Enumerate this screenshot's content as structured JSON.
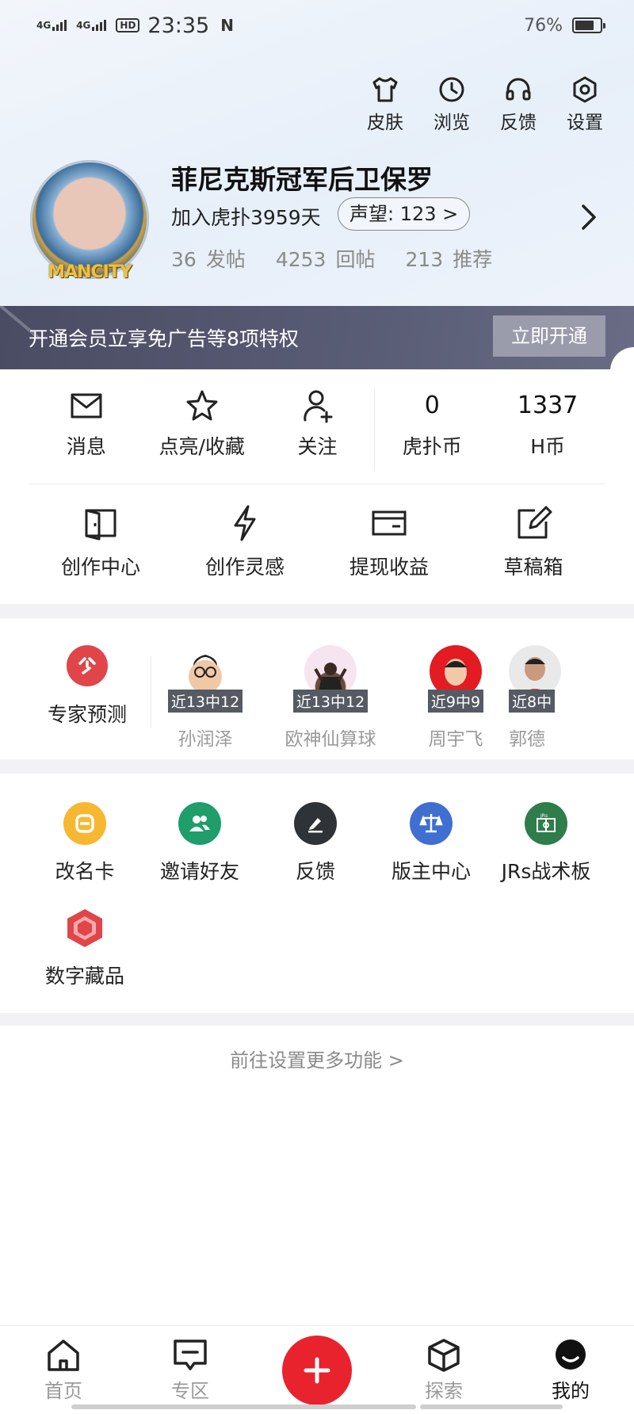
{
  "status_bar": {
    "net1": "4G",
    "net2": "4G",
    "hd": "HD",
    "time": "23:35",
    "nfc": "N",
    "battery": "76%",
    "battery_level": 0.76
  },
  "header_actions": [
    {
      "label": "皮肤",
      "icon": "shirt-icon"
    },
    {
      "label": "浏览",
      "icon": "clock-icon"
    },
    {
      "label": "反馈",
      "icon": "headset-icon"
    },
    {
      "label": "设置",
      "icon": "settings-icon"
    }
  ],
  "profile": {
    "username": "菲尼克斯冠军后卫保罗",
    "joined": "加入虎扑3959天",
    "reputation": "声望: 123",
    "avatar_badge": "MANCITY",
    "posts_count": "36",
    "posts_label": "发帖",
    "replies_count": "4253",
    "replies_label": "回帖",
    "recommend_count": "213",
    "recommend_label": "推荐"
  },
  "vip": {
    "text": "开通会员立享免广告等8项特权",
    "button": "立即开通"
  },
  "quick_row": [
    {
      "label": "消息",
      "icon": "mail-icon"
    },
    {
      "label": "点亮/收藏",
      "icon": "star-icon"
    },
    {
      "label": "关注",
      "icon": "add-user-icon"
    }
  ],
  "wallet": [
    {
      "value": "0",
      "label": "虎扑币"
    },
    {
      "value": "1337",
      "label": "H币"
    }
  ],
  "creator_row": [
    {
      "label": "创作中心",
      "icon": "door-icon"
    },
    {
      "label": "创作灵感",
      "icon": "lightning-icon"
    },
    {
      "label": "提现收益",
      "icon": "card-icon"
    },
    {
      "label": "草稿箱",
      "icon": "edit-icon"
    }
  ],
  "experts": {
    "title": "专家预测",
    "items": [
      {
        "tag": "近13中12",
        "name": "孙润泽"
      },
      {
        "tag": "近13中12",
        "name": "欧神仙算球"
      },
      {
        "tag": "近9中9",
        "name": "周宇飞"
      },
      {
        "tag": "近8中",
        "name": "郭德"
      }
    ]
  },
  "tools": [
    {
      "label": "改名卡",
      "color": "#f7b731"
    },
    {
      "label": "邀请好友",
      "color": "#1f9d6b"
    },
    {
      "label": "反馈",
      "color": "#2f3237"
    },
    {
      "label": "版主中心",
      "color": "#3f6fd1"
    },
    {
      "label": "JRs战术板",
      "color": "#2e7d4a"
    },
    {
      "label": "数字藏品",
      "color": "#e0454a"
    }
  ],
  "more_settings": "前往设置更多功能 >",
  "bottom_nav": [
    {
      "label": "首页",
      "icon": "home-icon"
    },
    {
      "label": "专区",
      "icon": "chat-icon"
    },
    {
      "label": "探索",
      "icon": "cube-icon"
    },
    {
      "label": "我的",
      "icon": "profile-icon"
    }
  ]
}
